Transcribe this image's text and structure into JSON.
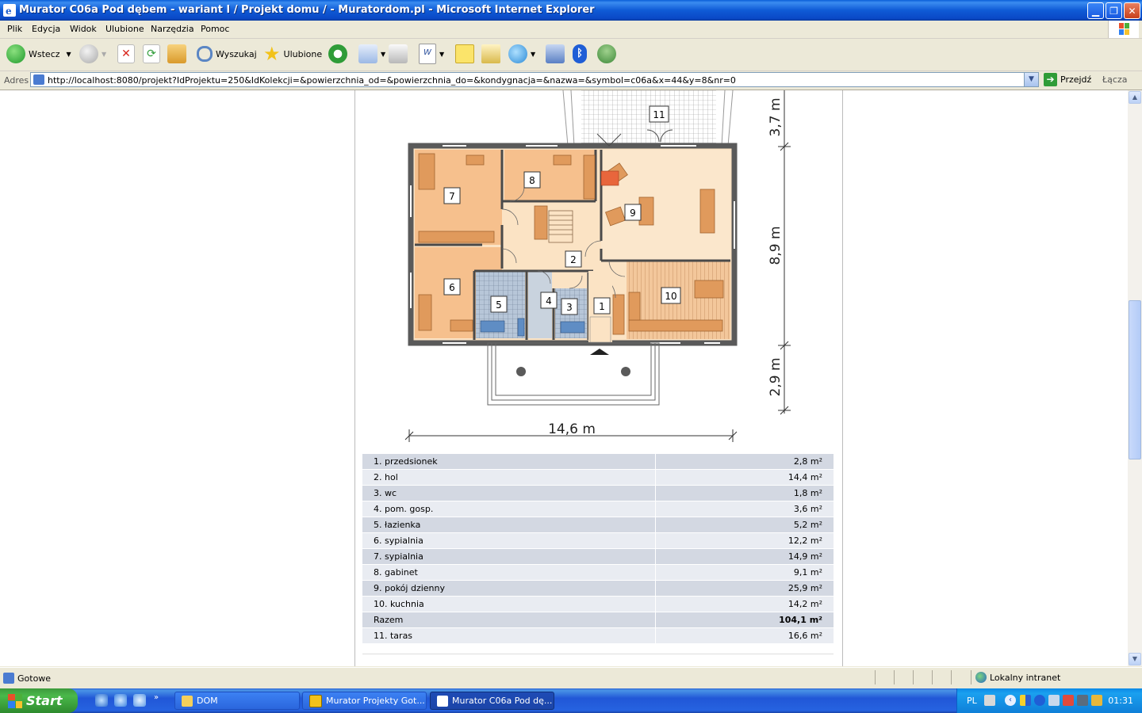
{
  "window": {
    "title": "Murator C06a Pod dębem - wariant I / Projekt domu / - Muratordom.pl - Microsoft Internet Explorer"
  },
  "menu": [
    "Plik",
    "Edycja",
    "Widok",
    "Ulubione",
    "Narzędzia",
    "Pomoc"
  ],
  "toolbar": {
    "back_label": "Wstecz",
    "search_label": "Wyszukaj",
    "favorites_label": "Ulubione"
  },
  "address": {
    "label": "Adres",
    "url": "http://localhost:8080/projekt?IdProjektu=250&IdKolekcji=&powierzchnia_od=&powierzchnia_do=&kondygnacja=&nazwa=&symbol=c06a&x=44&y=8&nr=0",
    "go_label": "Przejdź",
    "links_label": "Łącza"
  },
  "plan": {
    "width_label": "14,6 m",
    "dim_top": "3,7 m",
    "dim_mid": "8,9 m",
    "dim_bottom": "2,9 m",
    "room_numbers": [
      "1",
      "2",
      "3",
      "4",
      "5",
      "6",
      "7",
      "8",
      "9",
      "10",
      "11"
    ]
  },
  "areas": [
    {
      "name": "1. przedsionek",
      "value": "2,8 m²"
    },
    {
      "name": "2. hol",
      "value": "14,4 m²"
    },
    {
      "name": "3. wc",
      "value": "1,8 m²"
    },
    {
      "name": "4. pom. gosp.",
      "value": "3,6 m²"
    },
    {
      "name": "5. łazienka",
      "value": "5,2 m²"
    },
    {
      "name": "6. sypialnia",
      "value": "12,2 m²"
    },
    {
      "name": "7. sypialnia",
      "value": "14,9 m²"
    },
    {
      "name": "8. gabinet",
      "value": "9,1 m²"
    },
    {
      "name": "9. pokój dzienny",
      "value": "25,9 m²"
    },
    {
      "name": "10. kuchnia",
      "value": "14,2 m²"
    },
    {
      "name": "Razem",
      "value": "104,1 m²"
    },
    {
      "name": "11. taras",
      "value": "16,6 m²"
    }
  ],
  "status": {
    "text": "Gotowe",
    "zone": "Lokalny intranet"
  },
  "taskbar": {
    "start_label": "Start",
    "tasks": [
      "DOM",
      "Murator Projekty Got...",
      "Murator C06a Pod dę..."
    ],
    "lang": "PL",
    "clock": "01:31"
  }
}
